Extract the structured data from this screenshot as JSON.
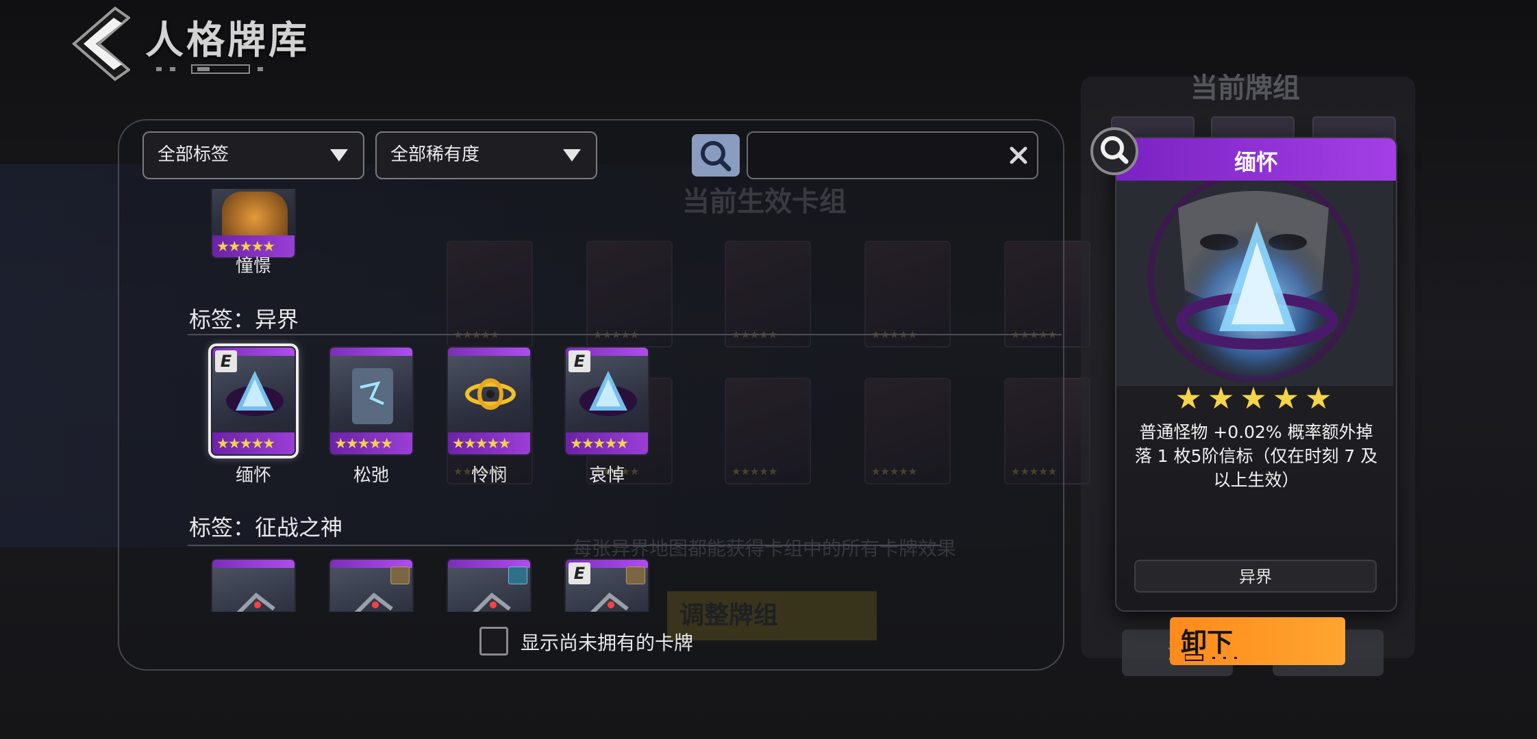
{
  "header": {
    "title": "人格牌库"
  },
  "background": {
    "deck_title": "当前生效卡组",
    "hint": "每张异界地图都能获得卡组中的所有卡牌效果",
    "adjust_label": "调整牌组",
    "right_title": "当前牌组",
    "right_btn_label": "清"
  },
  "filters": {
    "tag_filter": "全部标签",
    "rarity_filter": "全部稀有度",
    "search_placeholder": ""
  },
  "library": {
    "top_card_name": "憧憬",
    "sections": [
      {
        "label": "标签：异界",
        "cards": [
          {
            "name": "缅怀",
            "stars": "★★★★★",
            "badge": "E",
            "selected": true
          },
          {
            "name": "松弛",
            "stars": "★★★★★",
            "badge": "",
            "selected": false
          },
          {
            "name": "怜悯",
            "stars": "★★★★★",
            "badge": "",
            "selected": false
          },
          {
            "name": "哀悼",
            "stars": "★★★★★",
            "badge": "E",
            "selected": false
          }
        ]
      },
      {
        "label": "标签：征战之神",
        "cards": [
          {
            "name": "",
            "badge": ""
          },
          {
            "name": "",
            "badge": "",
            "icon": "chest-icon"
          },
          {
            "name": "",
            "badge": "",
            "icon": "mask-icon"
          },
          {
            "name": "",
            "badge": "E",
            "icon": "chest-icon"
          }
        ]
      }
    ],
    "top_card_stars": "★★★★★",
    "show_unowned_label": "显示尚未拥有的卡牌"
  },
  "detail": {
    "name": "缅怀",
    "stars": "★★★★★",
    "description": "普通怪物 +0.02% 概率额外掉落 1 枚5阶信标（仅在时刻 7 及以上生效）",
    "tag": "异界",
    "unload_label": "卸下"
  },
  "colors": {
    "accent_purple": "#9a3ed6",
    "star_gold": "#f3d34a",
    "unload_orange": "#ff8a1a"
  }
}
